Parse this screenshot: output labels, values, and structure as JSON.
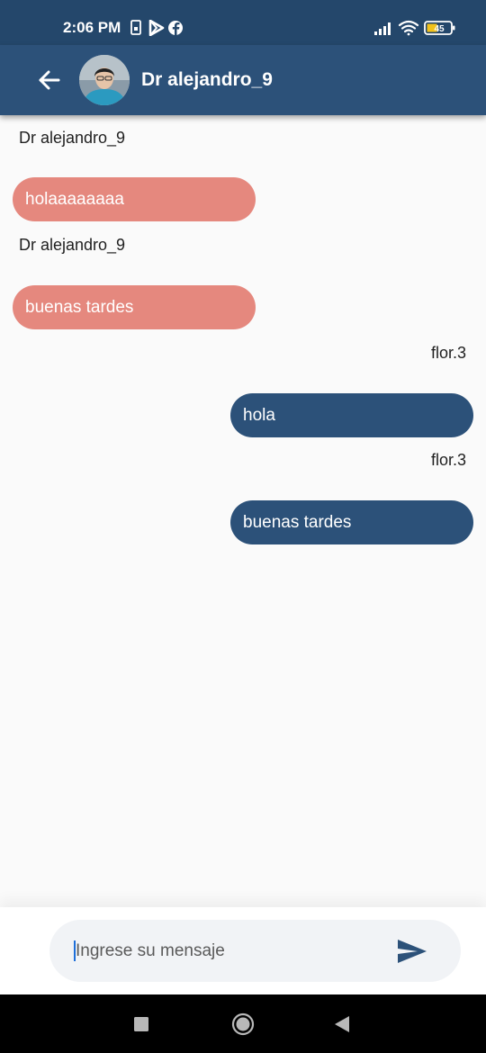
{
  "status_bar": {
    "time": "2:06 PM",
    "battery": "45",
    "icons_left": [
      "sim-icon",
      "play-store-icon",
      "facebook-icon"
    ],
    "icons_right": [
      "signal-icon",
      "wifi-icon",
      "battery-icon"
    ]
  },
  "header": {
    "title": "Dr alejandro_9",
    "back_icon": "arrow-left-icon",
    "avatar": "contact-avatar"
  },
  "messages": [
    {
      "sender": "Dr alejandro_9",
      "text": "holaaaaaaaa",
      "direction": "incoming"
    },
    {
      "sender": "Dr alejandro_9",
      "text": "buenas tardes",
      "direction": "incoming"
    },
    {
      "sender": "flor.3",
      "text": "hola",
      "direction": "outgoing"
    },
    {
      "sender": "flor.3",
      "text": "buenas tardes",
      "direction": "outgoing"
    }
  ],
  "composer": {
    "placeholder": "Ingrese su mensaje",
    "value": "",
    "send_icon": "send-icon"
  },
  "colors": {
    "status_bar": "#24476b",
    "app_bar": "#2c5179",
    "incoming_bubble": "#e5887e",
    "outgoing_bubble": "#2c5179",
    "background": "#fafafa"
  },
  "nav_bar": {
    "icons": [
      "recents-square-icon",
      "home-circle-icon",
      "back-triangle-icon"
    ]
  }
}
